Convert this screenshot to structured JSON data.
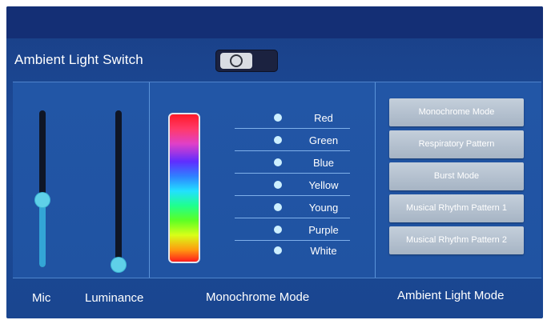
{
  "header": {
    "title": "Ambient Light Switch"
  },
  "toggle": {
    "state": "off"
  },
  "sliders": {
    "mic": {
      "label": "Mic",
      "value_fraction": 0.43
    },
    "luminance": {
      "label": "Luminance",
      "value_fraction": 0.0
    }
  },
  "colors": [
    {
      "label": "Red"
    },
    {
      "label": "Green"
    },
    {
      "label": "Blue"
    },
    {
      "label": "Yellow"
    },
    {
      "label": "Young"
    },
    {
      "label": "Purple"
    },
    {
      "label": "White"
    }
  ],
  "modes": [
    {
      "label": "Monochrome Mode"
    },
    {
      "label": "Respiratory Pattern"
    },
    {
      "label": "Burst Mode"
    },
    {
      "label": "Musical Rhythm Pattern 1"
    },
    {
      "label": "Musical Rhythm Pattern 2"
    }
  ],
  "footer": {
    "mic_label": "Mic",
    "luminance_label": "Luminance",
    "monochrome_label": "Monochrome Mode",
    "ambient_label": "Ambient Light Mode"
  },
  "theme": {
    "background": "#1c4a97",
    "accent": "#33a5d6",
    "button": "#b6c3d1"
  }
}
